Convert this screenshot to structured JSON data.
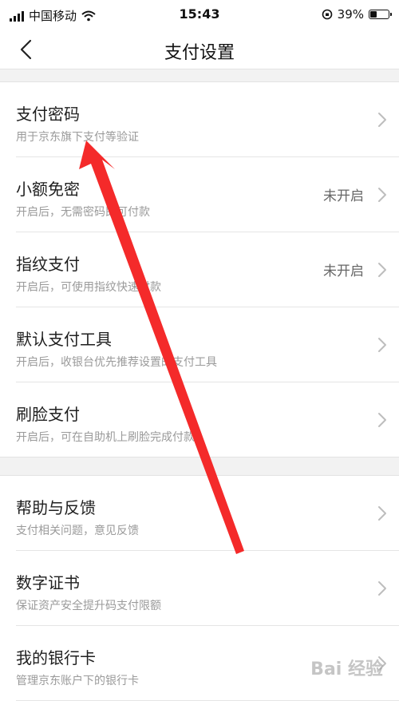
{
  "status": {
    "carrier": "中国移动",
    "time": "15:43",
    "battery": "39%",
    "battery_level": 0.39
  },
  "nav": {
    "title": "支付设置",
    "back_icon": "chevron-left-icon"
  },
  "group1": [
    {
      "title": "支付密码",
      "sub": "用于京东旗下支付等验证",
      "value": ""
    },
    {
      "title": "小额免密",
      "sub": "开启后，无需密码即可付款",
      "value": "未开启"
    },
    {
      "title": "指纹支付",
      "sub": "开启后，可使用指纹快速付款",
      "value": "未开启"
    },
    {
      "title": "默认支付工具",
      "sub": "开启后，收银台优先推荐设置的支付工具",
      "value": ""
    },
    {
      "title": "刷脸支付",
      "sub": "开启后，可在自助机上刷脸完成付款",
      "value": ""
    }
  ],
  "group2": [
    {
      "title": "帮助与反馈",
      "sub": "支付相关问题，意见反馈",
      "value": ""
    },
    {
      "title": "数字证书",
      "sub": "保证资产安全提升码支付限额",
      "value": ""
    },
    {
      "title": "我的银行卡",
      "sub": "管理京东账户下的银行卡",
      "value": ""
    }
  ],
  "watermark": "Bai 经验",
  "colors": {
    "arrow": "#f42a2a",
    "background_gap": "#f2f2f2"
  }
}
